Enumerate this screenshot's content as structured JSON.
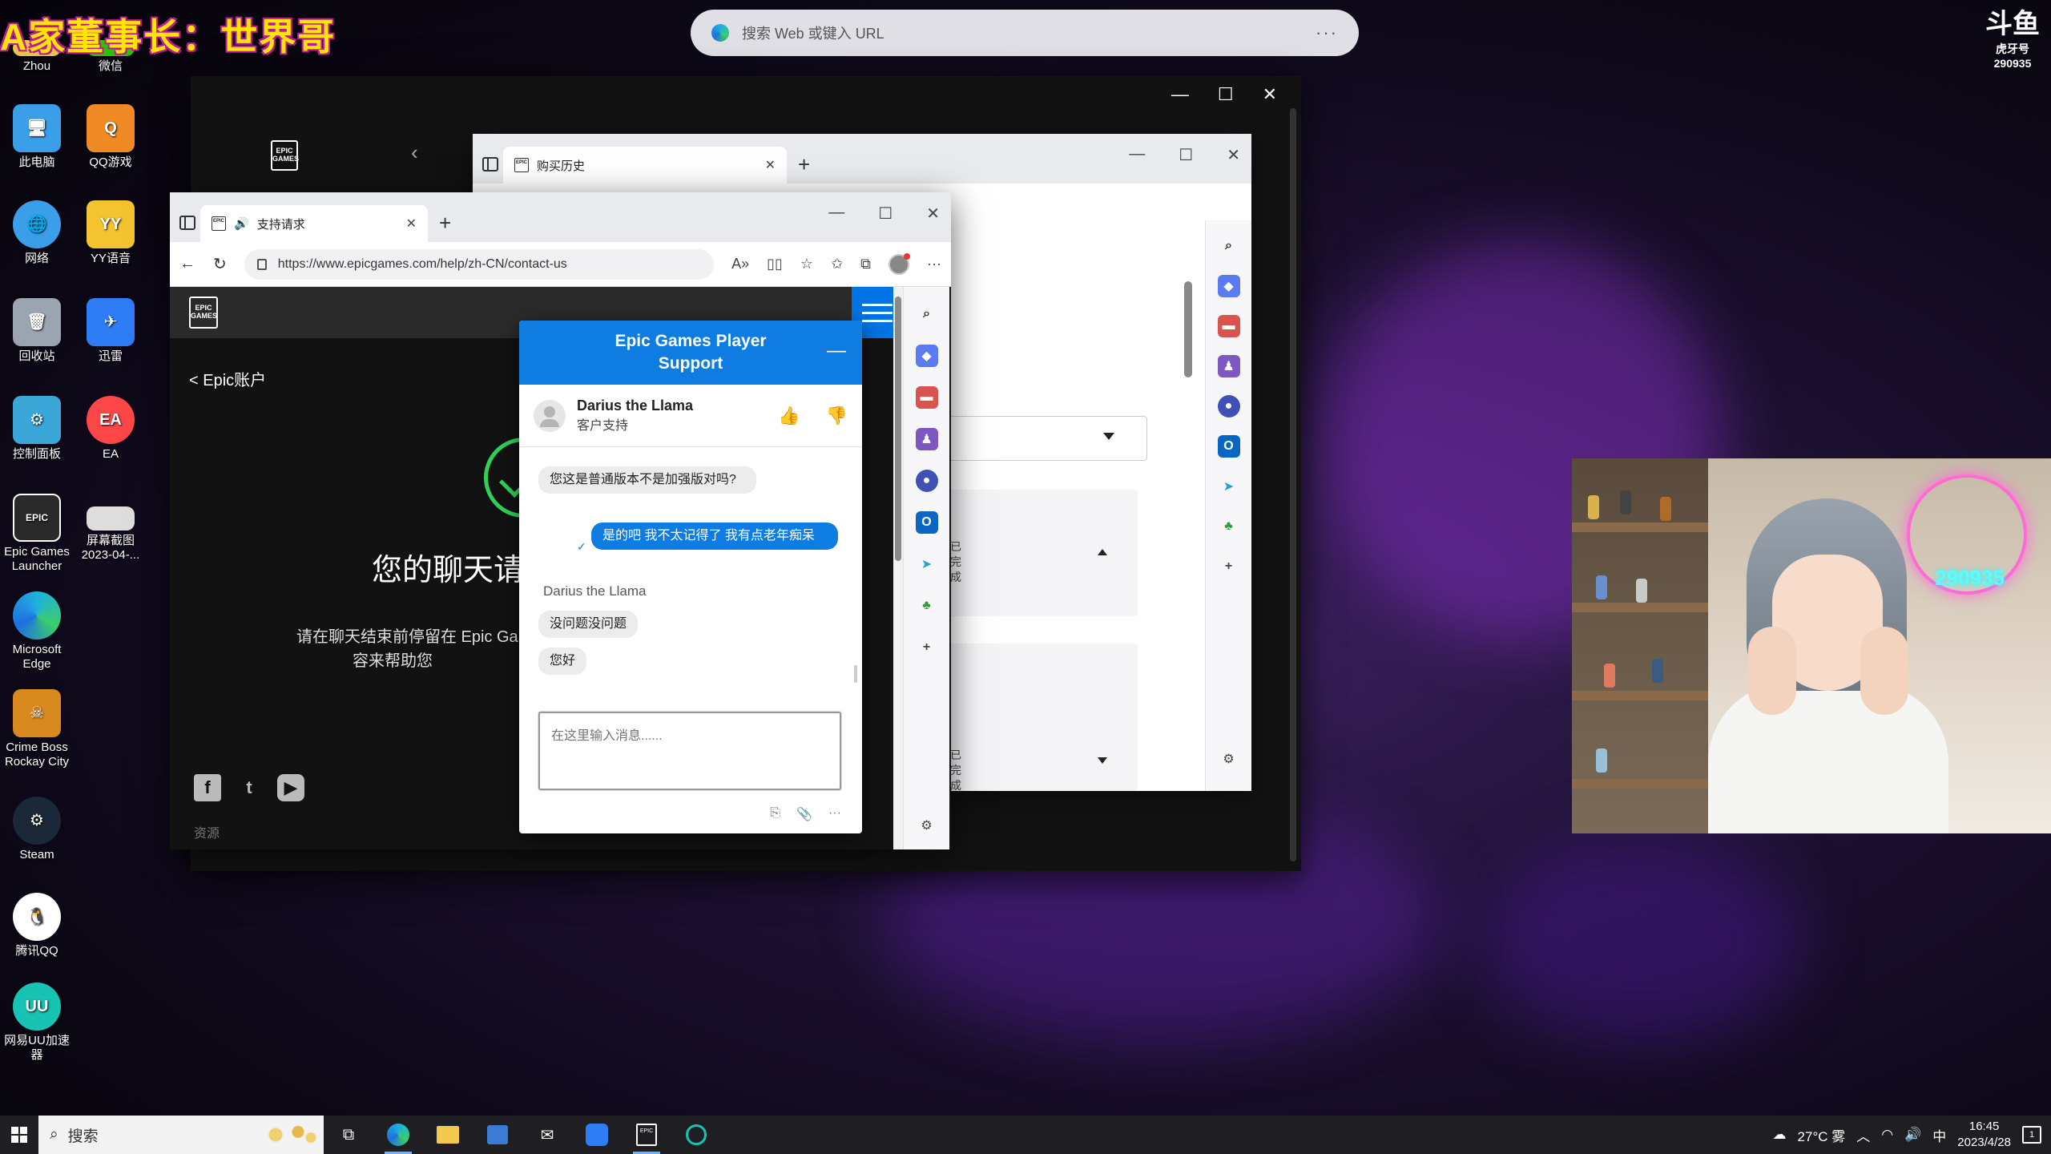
{
  "overlay": {
    "stream_title": "A家董事长：世界哥",
    "logo_glyph": "斗鱼",
    "logo_sub": "虎牙号",
    "logo_number": "290935"
  },
  "desktop_icons": [
    {
      "label": "Zhou",
      "icon": "folder-user-icon",
      "color": "#e8c34a"
    },
    {
      "label": "微信",
      "icon": "wechat-icon",
      "color": "#2dc100"
    },
    {
      "label": "此电脑",
      "icon": "computer-icon",
      "color": "#3a9ee8"
    },
    {
      "label": "QQ游戏",
      "icon": "qq-game-icon",
      "color": "#f08a24"
    },
    {
      "label": "网络",
      "icon": "network-icon",
      "color": "#3a9ee8"
    },
    {
      "label": "YY语音",
      "icon": "yy-voice-icon",
      "color": "#f4c430"
    },
    {
      "label": "回收站",
      "icon": "recycle-bin-icon",
      "color": "#9aa5b1"
    },
    {
      "label": "迅雷",
      "icon": "thunder-icon",
      "color": "#2f7df6"
    },
    {
      "label": "控制面板",
      "icon": "control-panel-icon",
      "color": "#3aa7d8"
    },
    {
      "label": "EA",
      "icon": "ea-icon",
      "color": "#ff4747"
    },
    {
      "label": "Epic Games Launcher",
      "icon": "epic-games-icon",
      "color": "#2a2a2a"
    },
    {
      "label": "屏幕截图 2023-04-...",
      "icon": "screenshot-file-icon",
      "color": "#dddddd"
    },
    {
      "label": "Microsoft Edge",
      "icon": "edge-icon",
      "color": "#1fa7e0"
    },
    {
      "label": "Crime Boss Rockay City",
      "icon": "crime-boss-icon",
      "color": "#d98a1f"
    },
    {
      "label": "Steam",
      "icon": "steam-icon",
      "color": "#1b2838"
    },
    {
      "label": "腾讯QQ",
      "icon": "qq-icon",
      "color": "#ffffff"
    },
    {
      "label": "网易UU加速器",
      "icon": "uu-accelerator-icon",
      "color": "#17c3b2"
    }
  ],
  "desktop_search": {
    "placeholder": "搜索 Web 或键入 URL",
    "more": "···"
  },
  "launcher": {
    "logo": "EPIC GAMES",
    "controls": {
      "minimize": "—",
      "maximize": "☐",
      "close": "✕"
    }
  },
  "browser_back": {
    "tab_title": "购买历史",
    "tab_close": "✕",
    "new_tab": "+",
    "controls": {
      "minimize": "—",
      "maximize": "☐",
      "close": "✕"
    },
    "card_text_1": "已\n完\n成",
    "card_text_2": "已\n完\n成"
  },
  "browser_front": {
    "tab_title": "支持请求",
    "tab_close": "✕",
    "new_tab": "+",
    "controls": {
      "minimize": "—",
      "maximize": "☐",
      "close": "✕"
    },
    "url": "https://www.epicgames.com/help/zh-CN/contact-us",
    "nav": {
      "back": "←",
      "reload": "↻",
      "more": "···"
    }
  },
  "epic_page": {
    "logo": "EPIC GAMES",
    "breadcrumb": "Epic账户",
    "breadcrumb_arrow": "<",
    "title": "您的聊天请",
    "subtitle_line1": "请在聊天结束前停留在 Epic Games 帮助页",
    "subtitle_line2": "容来帮助您",
    "socials": [
      "f",
      "t",
      "▶"
    ],
    "footer_heading": "资源"
  },
  "chat": {
    "header_line1": "Epic Games Player",
    "header_line2": "Support",
    "minimize": "—",
    "agent_name": "Darius the Llama",
    "agent_role": "客户支持",
    "messages": [
      {
        "from": "agent",
        "text": "您这是普通版本不是加强版对吗?"
      },
      {
        "from": "user",
        "text": "是的吧 我不太记得了 我有点老年痴呆"
      },
      {
        "from": "agent_label",
        "text": "Darius the Llama"
      },
      {
        "from": "agent",
        "text": "没问题没问题"
      },
      {
        "from": "agent",
        "text": "您好"
      }
    ],
    "input_placeholder": "在这里输入消息......"
  },
  "taskbar": {
    "search_placeholder": "搜索",
    "weather": "27°C 雾",
    "ime": "中",
    "time": "16:45",
    "date": "2023/4/28",
    "notification_count": "1"
  }
}
